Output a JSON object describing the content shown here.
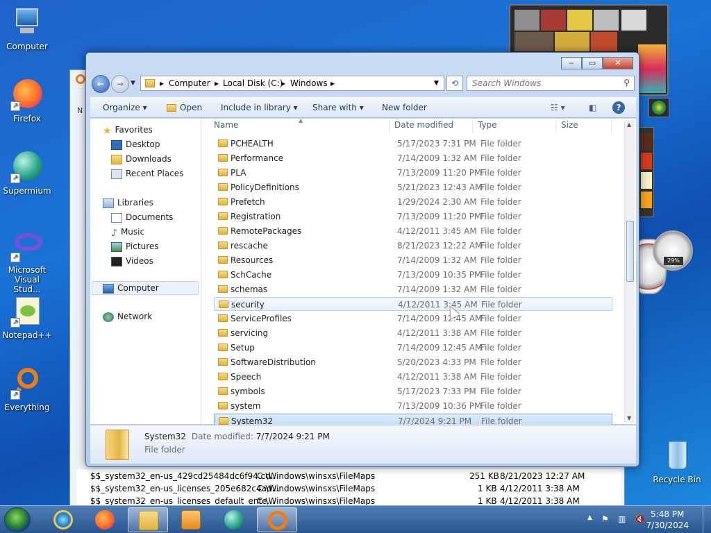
{
  "desktop": {
    "icons": [
      {
        "label": "Computer"
      },
      {
        "label": "Firefox"
      },
      {
        "label": "Supermium"
      },
      {
        "label": "Microsoft Visual Stud..."
      },
      {
        "label": "Notepad++"
      },
      {
        "label": "Everything"
      },
      {
        "label": "Recycle Bin"
      }
    ]
  },
  "background_window": {
    "rows": [
      {
        "name": "$$_system32_en-us_429cd25484dc6f94.cd...",
        "folder": "C:\\Windows\\winsxs\\FileMaps",
        "size": "251 KB",
        "date": "8/21/2023 12:27 AM"
      },
      {
        "name": "$$_system32_en-us_licenses_205e682c4ad...",
        "folder": "C:\\Windows\\winsxs\\FileMaps",
        "size": "1 KB",
        "date": "4/12/2011 3:38 AM"
      },
      {
        "name": "$$_system32_en-us_licenses_default_ente...",
        "folder": "C:\\Windows\\winsxs\\FileMaps",
        "size": "1 KB",
        "date": "4/12/2011 3:38 AM"
      }
    ]
  },
  "window": {
    "address": {
      "crumbs": [
        "Computer",
        "Local Disk (C:)",
        "Windows"
      ]
    },
    "search": {
      "placeholder": "Search Windows"
    },
    "toolbar": {
      "organize": "Organize",
      "open": "Open",
      "include": "Include in library",
      "share": "Share with",
      "new_folder": "New folder"
    },
    "nav": {
      "favorites": "Favorites",
      "desktop": "Desktop",
      "downloads": "Downloads",
      "recent": "Recent Places",
      "libraries": "Libraries",
      "documents": "Documents",
      "music": "Music",
      "pictures": "Pictures",
      "videos": "Videos",
      "computer": "Computer",
      "network": "Network"
    },
    "columns": {
      "name": "Name",
      "date": "Date modified",
      "type": "Type",
      "size": "Size"
    },
    "files": [
      {
        "name": "PCHEALTH",
        "date": "5/17/2023 7:31 PM",
        "type": "File folder"
      },
      {
        "name": "Performance",
        "date": "7/14/2009 1:32 AM",
        "type": "File folder"
      },
      {
        "name": "PLA",
        "date": "7/13/2009 11:20 PM",
        "type": "File folder"
      },
      {
        "name": "PolicyDefinitions",
        "date": "5/21/2023 12:43 AM",
        "type": "File folder"
      },
      {
        "name": "Prefetch",
        "date": "1/29/2024 2:30 AM",
        "type": "File folder"
      },
      {
        "name": "Registration",
        "date": "7/13/2009 11:20 PM",
        "type": "File folder"
      },
      {
        "name": "RemotePackages",
        "date": "4/12/2011 3:45 AM",
        "type": "File folder"
      },
      {
        "name": "rescache",
        "date": "8/21/2023 12:22 AM",
        "type": "File folder"
      },
      {
        "name": "Resources",
        "date": "7/14/2009 1:32 AM",
        "type": "File folder"
      },
      {
        "name": "SchCache",
        "date": "7/13/2009 10:35 PM",
        "type": "File folder"
      },
      {
        "name": "schemas",
        "date": "7/14/2009 1:32 AM",
        "type": "File folder"
      },
      {
        "name": "security",
        "date": "4/12/2011 3:45 AM",
        "type": "File folder"
      },
      {
        "name": "ServiceProfiles",
        "date": "7/14/2009 12:45 AM",
        "type": "File folder"
      },
      {
        "name": "servicing",
        "date": "4/12/2011 3:38 AM",
        "type": "File folder"
      },
      {
        "name": "Setup",
        "date": "7/14/2009 12:45 AM",
        "type": "File folder"
      },
      {
        "name": "SoftwareDistribution",
        "date": "5/20/2023 4:33 PM",
        "type": "File folder"
      },
      {
        "name": "Speech",
        "date": "4/12/2011 3:38 AM",
        "type": "File folder"
      },
      {
        "name": "symbols",
        "date": "5/17/2023 7:33 PM",
        "type": "File folder"
      },
      {
        "name": "system",
        "date": "7/13/2009 10:36 PM",
        "type": "File folder"
      },
      {
        "name": "System32",
        "date": "7/7/2024 9:21 PM",
        "type": "File folder"
      }
    ],
    "details": {
      "name": "System32",
      "date_label": "Date modified:",
      "date": "7/7/2024 9:21 PM",
      "type": "File folder"
    }
  },
  "gadgets": {
    "cpu_percent": "29%"
  },
  "taskbar": {
    "time": "5:48 PM",
    "date": "7/30/2024"
  }
}
